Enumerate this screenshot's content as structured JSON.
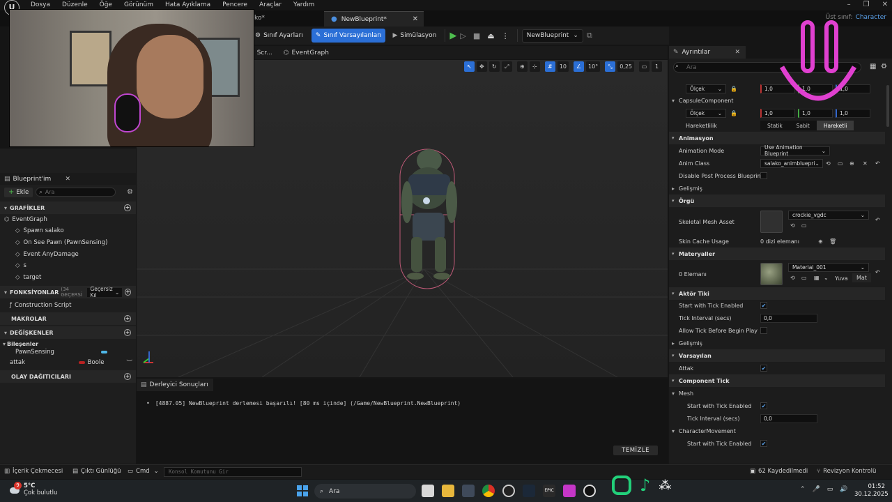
{
  "menubar": {
    "logo": "U",
    "items": [
      "Dosya",
      "Düzenle",
      "Öğe",
      "Görünüm",
      "Hata Ayıklama",
      "Pencere",
      "Araçlar",
      "Yardım"
    ]
  },
  "tabs": {
    "stub": "ko*",
    "active": "NewBlueprint*"
  },
  "parent_class": {
    "label": "Üst sınıf:",
    "value": "Character"
  },
  "toolbar": {
    "class_settings": "Sınıf Ayarları",
    "class_defaults": "Sınıf Varsayılanları",
    "simulation": "Simülasyon",
    "debug_object": "NewBlueprint"
  },
  "graph_tabs": {
    "construction_stub": "n Scr...",
    "event_graph": "EventGraph"
  },
  "viewport": {
    "grid_snap": "10",
    "rot_snap": "10°",
    "scale_snap": "0,25",
    "camera_speed": "1"
  },
  "my_blueprint": {
    "title": "Blueprint'im",
    "add": "Ekle",
    "search_placeholder": "Ara",
    "sections": {
      "graphs": "GRAFİKLER",
      "functions": "FONKSİYONLAR",
      "functions_count": "(34 GEÇERSİ",
      "functions_override": "Geçersiz Kıl",
      "macros": "MAKROLAR",
      "variables": "DEĞİŞKENLER",
      "dispatchers": "OLAY DAĞITICILARI"
    },
    "event_graph": "EventGraph",
    "events": [
      "Spawn salako",
      "On See Pawn (PawnSensing)",
      "Event AnyDamage",
      "s",
      "target"
    ],
    "construction": "Construction Script",
    "components_label": "Bileşenler",
    "components": [
      "PawnSensing"
    ],
    "variables": [
      {
        "name": "attak",
        "type": "Boole"
      }
    ]
  },
  "compiler": {
    "tab": "Derleyici Sonuçları",
    "log": "[4887.05] NewBlueprint derlemesi başarılı! [80 ms içinde] (/Game/NewBlueprint.NewBlueprint)",
    "clear": "TEMİZLE"
  },
  "details": {
    "tab": "Ayrıntılar",
    "search_placeholder": "Ara",
    "scale_label": "Ölçek",
    "scale_values": [
      "1,0",
      "1,0",
      "1,0"
    ],
    "capsule": "CapsuleComponent",
    "mobility_label": "Hareketlilik",
    "mobility": [
      "Statik",
      "Sabit",
      "Hareketli"
    ],
    "animation": {
      "title": "Animasyon",
      "mode_label": "Animation Mode",
      "mode": "Use Animation Blueprint",
      "class_label": "Anim Class",
      "class": "salako_animbluepri",
      "disable_pp": "Disable Post Process Blueprint",
      "advanced": "Gelişmiş"
    },
    "mesh": {
      "title": "Örgü",
      "asset_label": "Skeletal Mesh Asset",
      "asset": "crockie_vgdc",
      "skin_cache_label": "Skin Cache Usage",
      "skin_cache": "0 dizi elemanı"
    },
    "materials": {
      "title": "Materyaller",
      "count": "0 Elemanı",
      "material": "Material_001",
      "slot": "Yuva",
      "mat": "Mat"
    },
    "actor_tick": {
      "title": "Aktör Tiki",
      "start": "Start with Tick Enabled",
      "interval": "Tick Interval (secs)",
      "interval_value": "0,0",
      "before_play": "Allow Tick Before Begin Play",
      "advanced": "Gelişmiş"
    },
    "defaults": {
      "title": "Varsayılan",
      "attak": "Attak"
    },
    "component_tick": {
      "title": "Component Tick",
      "mesh": "Mesh",
      "start": "Start with Tick Enabled",
      "interval": "Tick Interval (secs)",
      "interval_value": "0,0",
      "movement": "CharacterMovement",
      "movement_start": "Start with Tick Enabled"
    }
  },
  "statusbar": {
    "content_drawer": "İçerik Çekmecesi",
    "output_log": "Çıktı Günlüğü",
    "cmd": "Cmd",
    "console_placeholder": "Konsol Komutunu Gir",
    "saved": "62 Kaydedilmedi",
    "revision": "Revizyon Kontrolü"
  },
  "taskbar": {
    "weather_temp": "5°C",
    "weather_desc": "Çok bulutlu",
    "weather_badge": "9",
    "search": "Ara",
    "time": "01:52",
    "date": "30.12.2025"
  },
  "colors": {
    "accent": "#2b6fd6",
    "overlay_pink": "#e040d0",
    "overlay_green": "#22d07a"
  }
}
